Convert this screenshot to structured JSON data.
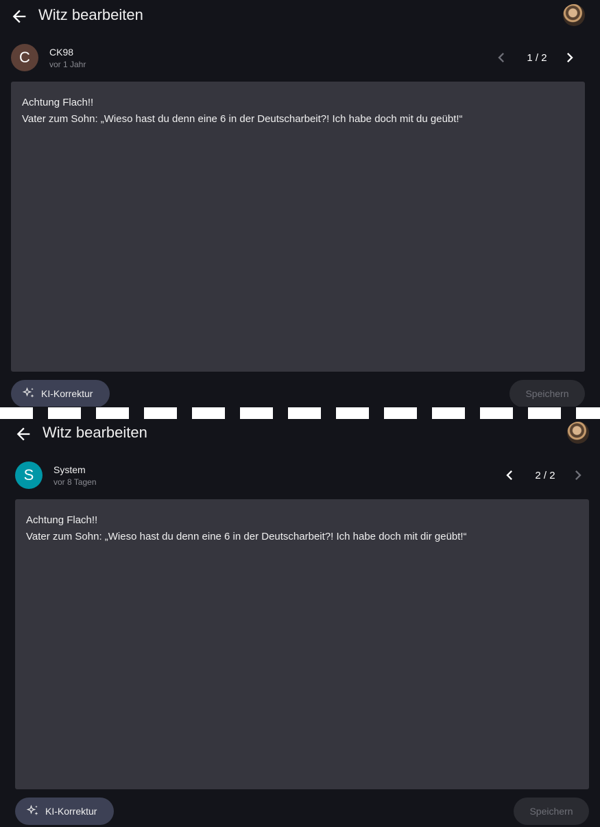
{
  "colors": {
    "background": "#13141a",
    "editor": "#36363e",
    "ki_button": "#3d4155",
    "save_button_disabled": "#2a2b31",
    "avatar_ck98": "#5d4037",
    "avatar_system": "#0097a7"
  },
  "panels": [
    {
      "title": "Witz bearbeiten",
      "author": {
        "initial": "C",
        "name": "CK98",
        "time": "vor 1 Jahr"
      },
      "pager": {
        "count": "1 / 2",
        "prev_enabled": false,
        "next_enabled": true
      },
      "text": {
        "line1": "Achtung Flach!!",
        "line2": "Vater zum Sohn: „Wieso hast du denn eine 6 in der Deutscharbeit?! Ich habe doch mit du geübt!“"
      },
      "ki_label": "KI-Korrektur",
      "save_label": "Speichern"
    },
    {
      "title": "Witz bearbeiten",
      "author": {
        "initial": "S",
        "name": "System",
        "time": "vor 8 Tagen"
      },
      "pager": {
        "count": "2 / 2",
        "prev_enabled": true,
        "next_enabled": false
      },
      "text": {
        "line1": "Achtung Flach!!",
        "line2": "Vater zum Sohn: „Wieso hast du denn eine 6 in der Deutscharbeit?! Ich habe doch mit dir geübt!“"
      },
      "ki_label": "KI-Korrektur",
      "save_label": "Speichern"
    }
  ],
  "icons": {
    "back": "arrow-left-icon",
    "prev": "chevron-left-icon",
    "next": "chevron-right-icon",
    "ki": "sparkles-icon"
  }
}
